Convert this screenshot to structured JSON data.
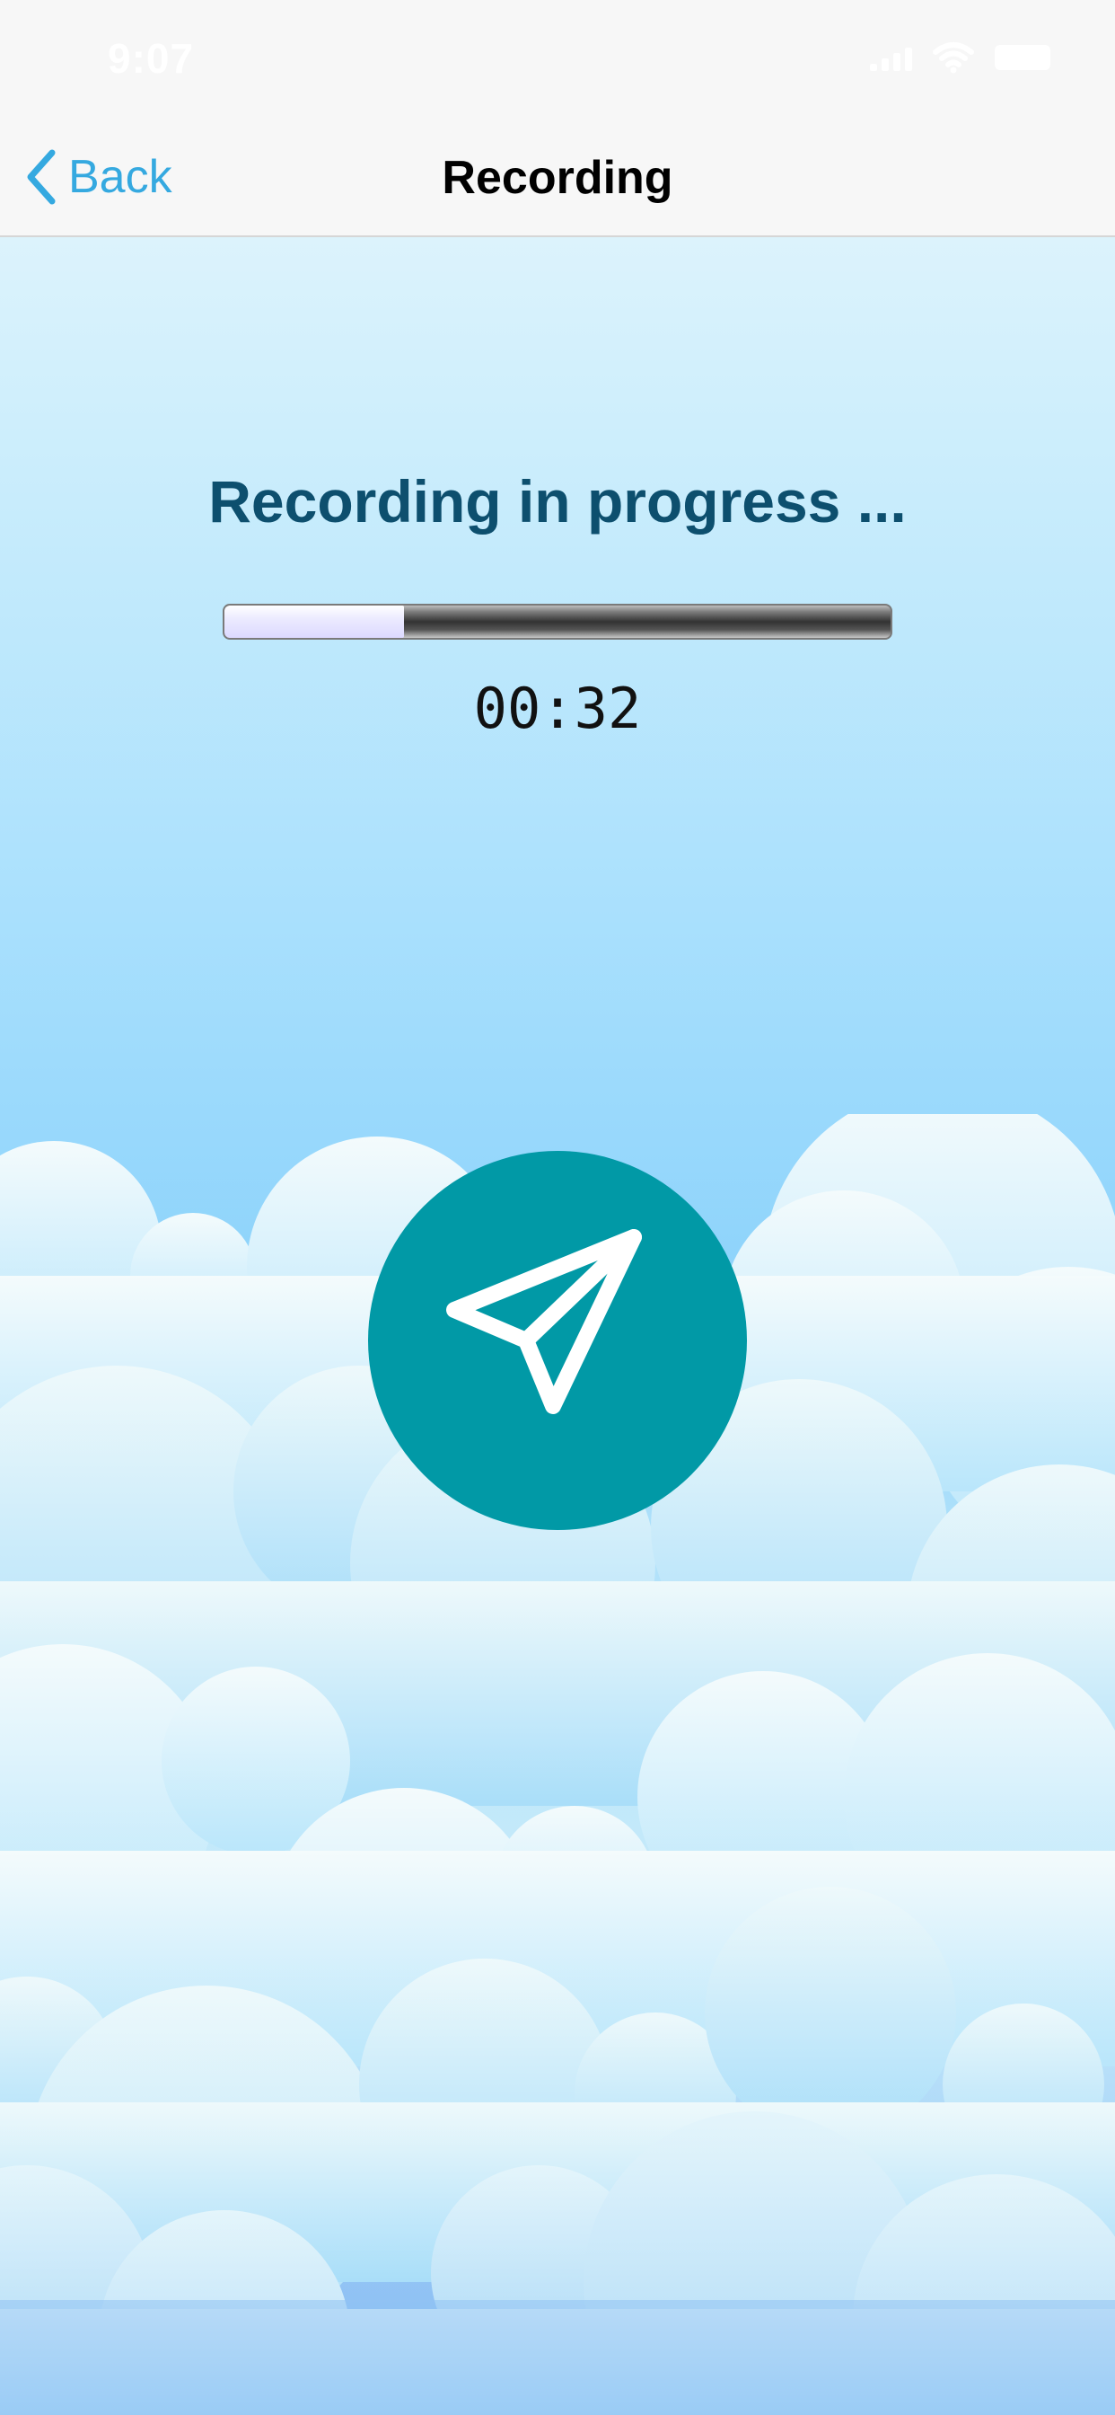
{
  "status_bar": {
    "time": "9:07"
  },
  "nav": {
    "back_label": "Back",
    "title": "Recording"
  },
  "main": {
    "heading": "Recording in progress ...",
    "progress_fraction": 0.27,
    "timer": "00:32"
  },
  "icons": {
    "back": "chevron-left-icon",
    "send": "paper-plane-icon",
    "wifi": "wifi-icon",
    "battery": "battery-icon"
  },
  "colors": {
    "accent": "#35a9e0",
    "heading": "#0d4f6e",
    "send_button": "#0199a6"
  }
}
